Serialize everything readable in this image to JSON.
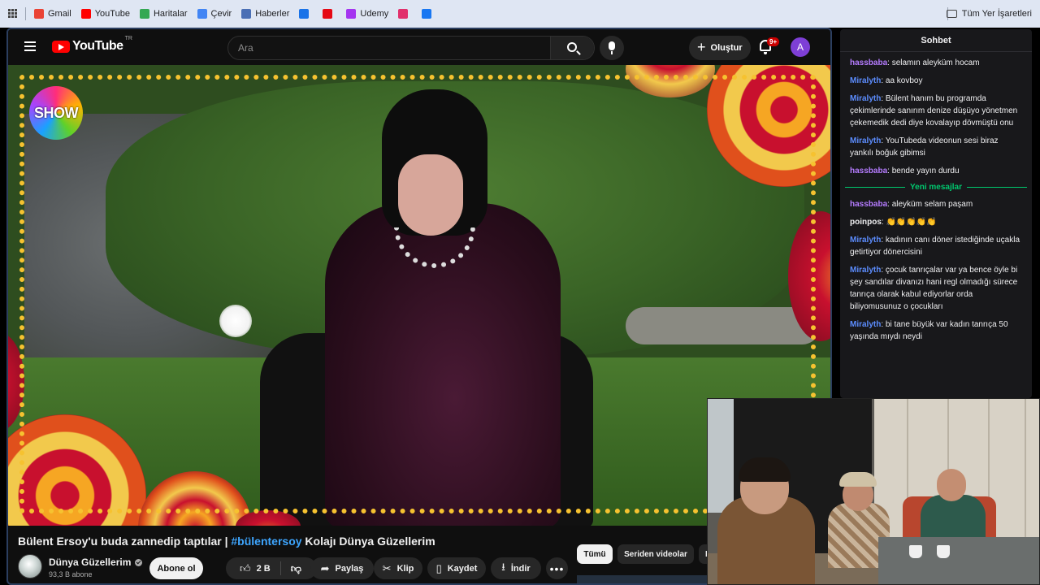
{
  "bookmarks": {
    "items": [
      {
        "label": "Gmail",
        "color": "#ea4335"
      },
      {
        "label": "YouTube",
        "color": "#ff0000"
      },
      {
        "label": "Haritalar",
        "color": "#34a853"
      },
      {
        "label": "Çevir",
        "color": "#4285f4"
      },
      {
        "label": "Haberler",
        "color": "#4a6fb5"
      },
      {
        "label": "",
        "color": "#1a73e8"
      },
      {
        "label": "",
        "color": "#e50914"
      },
      {
        "label": "Udemy",
        "color": "#a435f0"
      },
      {
        "label": "",
        "color": "#e1306c"
      },
      {
        "label": "",
        "color": "#1877f2"
      }
    ],
    "all_bookmarks": "Tüm Yer İşaretleri"
  },
  "youtube": {
    "logo_text": "YouTube",
    "country": "TR",
    "search_placeholder": "Ara",
    "create_label": "Oluştur",
    "notifications_badge": "9+",
    "avatar_letter": "A"
  },
  "video": {
    "channel_logo_text": "SHOW",
    "title_part1": "Bülent Ersoy'u buda zannedip taptılar | ",
    "title_hashtag": "#bülentersoy",
    "title_part2": " Kolajı Dünya Güzellerim",
    "channel_name": "Dünya Güzellerim",
    "subscribers": "93,3 B abone",
    "subscribe_label": "Abone ol",
    "likes": "2 B",
    "share_label": "Paylaş",
    "clip_label": "Klip",
    "save_label": "Kaydet",
    "download_label": "İndir",
    "more_label": "•••"
  },
  "filters": {
    "all": "Tümü",
    "series": "Seriden videolar",
    "cut": "D"
  },
  "chat": {
    "header": "Sohbet",
    "new_messages_label": "Yeni mesajlar",
    "messages_before": [
      {
        "user": "hassbaba",
        "color": "#b57cff",
        "text": ": selamın aleyküm hocam"
      },
      {
        "user": "Miralyth",
        "color": "#5c8dff",
        "text": ": aa kovboy"
      },
      {
        "user": "Miralyth",
        "color": "#5c8dff",
        "text": ": Bülent hanım bu programda çekimlerinde sanırım denize düşüyo yönetmen çekemedik dedi diye kovalayıp dövmüştü onu"
      },
      {
        "user": "Miralyth",
        "color": "#5c8dff",
        "text": ": YouTubeda videonun sesi biraz yankılı boğuk gibimsi"
      },
      {
        "user": "hassbaba",
        "color": "#b57cff",
        "text": ": bende yayın durdu"
      }
    ],
    "messages_after": [
      {
        "user": "hassbaba",
        "color": "#b57cff",
        "text": ": aleyküm selam paşam"
      },
      {
        "user": "poinpos",
        "color": "#efeff1",
        "text": ": 👏👏👏👏👏"
      },
      {
        "user": "Miralyth",
        "color": "#5c8dff",
        "text": ": kadının canı döner istediğinde uçakla getirtiyor dönercisini"
      },
      {
        "user": "Miralyth",
        "color": "#5c8dff",
        "text": ": çocuk tanrıçalar var ya bence öyle bi şey sandılar divanızı hani regl olmadığı sürece tanrıça olarak kabul ediyorlar orda biliyomusunuz o çocukları"
      },
      {
        "user": "Miralyth",
        "color": "#5c8dff",
        "text": ": bi tane büyük var kadın tanrıça 50 yaşında mıydı neydi"
      }
    ]
  }
}
